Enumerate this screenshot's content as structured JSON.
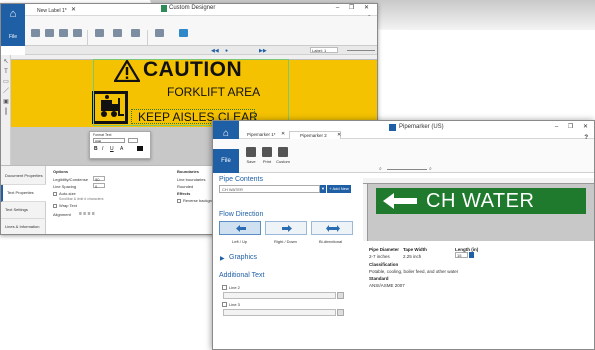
{
  "designer": {
    "app_title": "Custom Designer",
    "tab_label": "New Label 1*",
    "file_label": "File",
    "help": "?",
    "window_controls": "– ❐ ✕",
    "page_label": "Label: 1",
    "canvas": {
      "caution": "CAUTION",
      "area": "FORKLIFT AREA",
      "aisles": "KEEP AISLES CLEAR"
    },
    "format_popup": {
      "title": "Format Text",
      "font": "Arial",
      "bold": "B",
      "italic": "I",
      "underline": "U"
    },
    "side_tabs": [
      "Document Properties",
      "Text Properties",
      "Text Settings",
      "Lines & Information"
    ],
    "options": {
      "heading": "Options",
      "legibility": "Legibility/Condense",
      "legibility_value": "90",
      "line_spacing": "Line Spacing",
      "line_spacing_value": "0",
      "auto_size": "Auto-size",
      "wrap_text": "Wrap Text",
      "max_chars": "Scrollbar & limit # characters",
      "alignment": "Alignment"
    },
    "boundaries": {
      "heading": "Boundaries",
      "effects": "Effects",
      "line_boundaries": "Line boundaries",
      "rounded": "Rounded",
      "reverse": "Reverse background"
    }
  },
  "pipemarker": {
    "app_title": "Pipemarker (US)",
    "tabs": [
      "Pipemarker 1*",
      "Pipemarker 2"
    ],
    "file_label": "File",
    "help": "?",
    "window_controls": "– ❐ ✕",
    "ribbon": [
      "Save",
      "Print",
      "Custom"
    ],
    "pipe_contents": {
      "heading": "Pipe Contents",
      "selected": "CH WATER",
      "add_new": "+ Add New"
    },
    "flow_direction": {
      "heading": "Flow Direction",
      "options": [
        "Left / Up",
        "Right / Down",
        "Bi-directional"
      ]
    },
    "graphics_heading": "Graphics",
    "additional_text": {
      "heading": "Additional Text",
      "line2": "Line 2",
      "line3": "Line 3"
    },
    "preview": {
      "label_text": "CH WATER",
      "label_color": "#1f7a2e",
      "pipe_diameter_head": "Pipe Diameter",
      "pipe_diameter_val": "2-7 inches",
      "tape_width_head": "Tape Width",
      "tape_width_val": "2.25 inch",
      "length_head": "Length (in)",
      "length_val": "15",
      "classification_head": "Classification",
      "classification_val": "Potable, cooling, boiler feed, and other water",
      "standard_head": "Standard",
      "standard_val": "ANSI/ASME 2007"
    }
  },
  "colors": {
    "accent": "#1f5fa6",
    "caution_yellow": "#f4c200",
    "pipe_green": "#1f7a2e"
  }
}
